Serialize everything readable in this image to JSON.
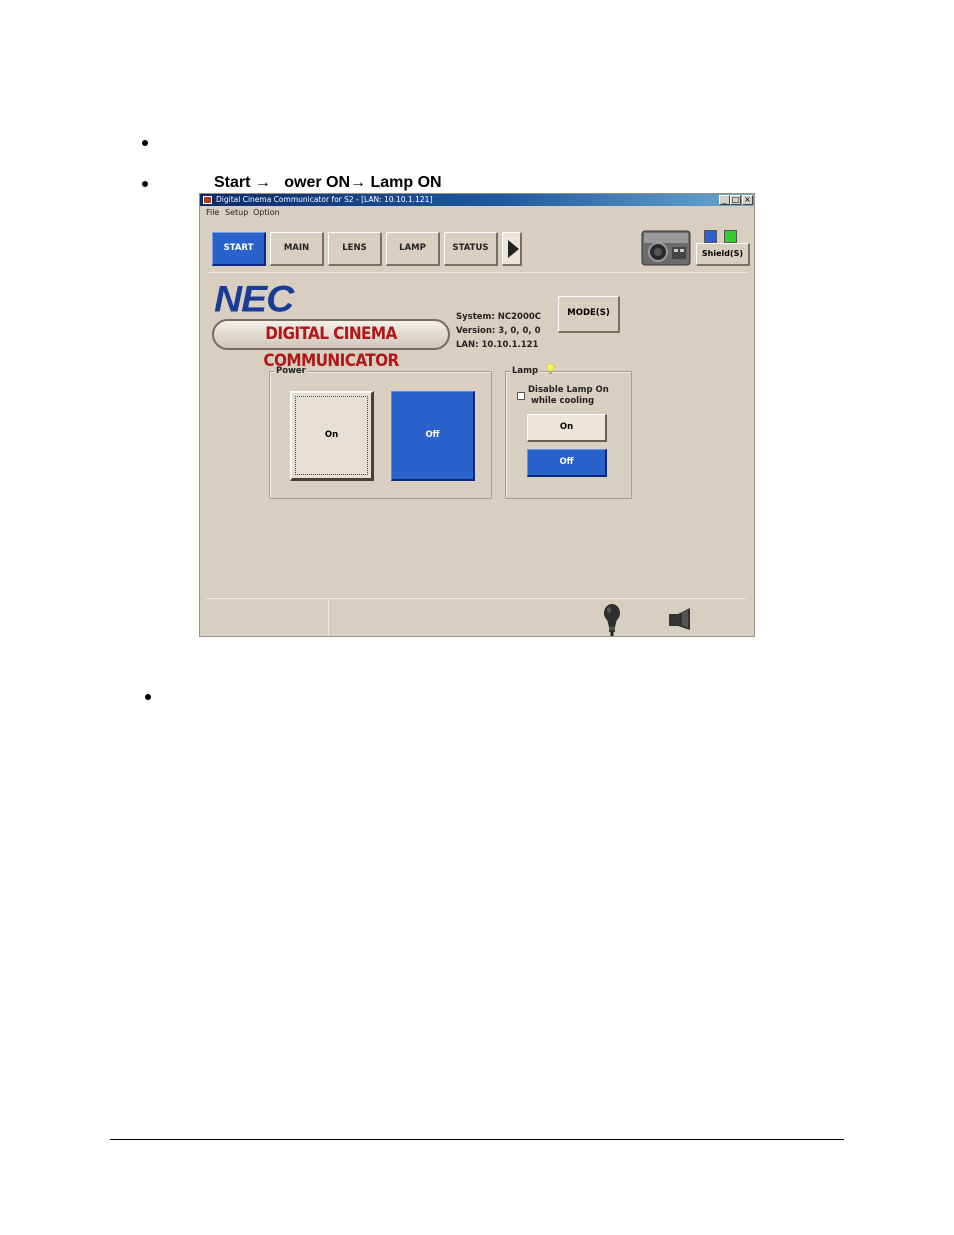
{
  "document": {
    "instruction": {
      "arrow": "→",
      "p1": "Start ",
      "p2": "   ower ON",
      "p3": " Lamp ON"
    }
  },
  "window": {
    "title": "Digital Cinema Communicator for S2 - [LAN: 10.10.1.121]",
    "controls": {
      "minimize": "_",
      "maximize": "□",
      "close": "×"
    },
    "menu": [
      "File",
      "Setup",
      "Option"
    ]
  },
  "tabs": [
    {
      "label": "START",
      "active": true
    },
    {
      "label": "MAIN",
      "active": false
    },
    {
      "label": "LENS",
      "active": false
    },
    {
      "label": "LAMP",
      "active": false
    },
    {
      "label": "STATUS",
      "active": false
    }
  ],
  "shield": {
    "label": "Shield(S)",
    "indicator_colors": [
      "#2d5fd0",
      "#33cc33"
    ]
  },
  "branding": {
    "logo": "NEC",
    "banner": "DIGITAL CINEMA COMMUNICATOR"
  },
  "system_info": {
    "system": "System: NC2000C",
    "version": "Version: 3, 0, 0, 0",
    "lan": "LAN: 10.10.1.121"
  },
  "mode_button": "MODE(S)",
  "power": {
    "label": "Power",
    "on": "On",
    "off": "Off",
    "selected": "Off"
  },
  "lamp": {
    "label": "Lamp",
    "checkbox_label_1": "Disable Lamp On",
    "checkbox_label_2": "while cooling",
    "checkbox_checked": false,
    "on": "On",
    "off": "Off",
    "selected": "Off"
  },
  "colors": {
    "accent_blue": "#2a62cc",
    "window_bg": "#d9cfc0",
    "brand_red": "#b01818",
    "brand_blue": "#1a3c96"
  },
  "icons": [
    "projector-icon",
    "lamp-bulb-icon",
    "speaker-icon"
  ]
}
